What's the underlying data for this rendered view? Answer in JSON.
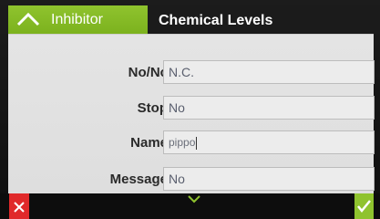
{
  "colors": {
    "accent": "#8fc32e",
    "cancel": "#e0292a",
    "panel": "#e1e1e1",
    "header": "#1b1b1b"
  },
  "header": {
    "back_label": "Inhibitor",
    "title": "Chemical Levels"
  },
  "form": {
    "rows": [
      {
        "label": "No/Nc",
        "value": "N.C."
      },
      {
        "label": "Stop",
        "value": "No"
      },
      {
        "label": "Name",
        "value": "pippo"
      },
      {
        "label": "Message",
        "value": "No"
      }
    ]
  },
  "footer": {
    "cancel_icon": "close-icon",
    "confirm_icon": "check-icon",
    "scroll_icon": "chevron-down-icon"
  }
}
